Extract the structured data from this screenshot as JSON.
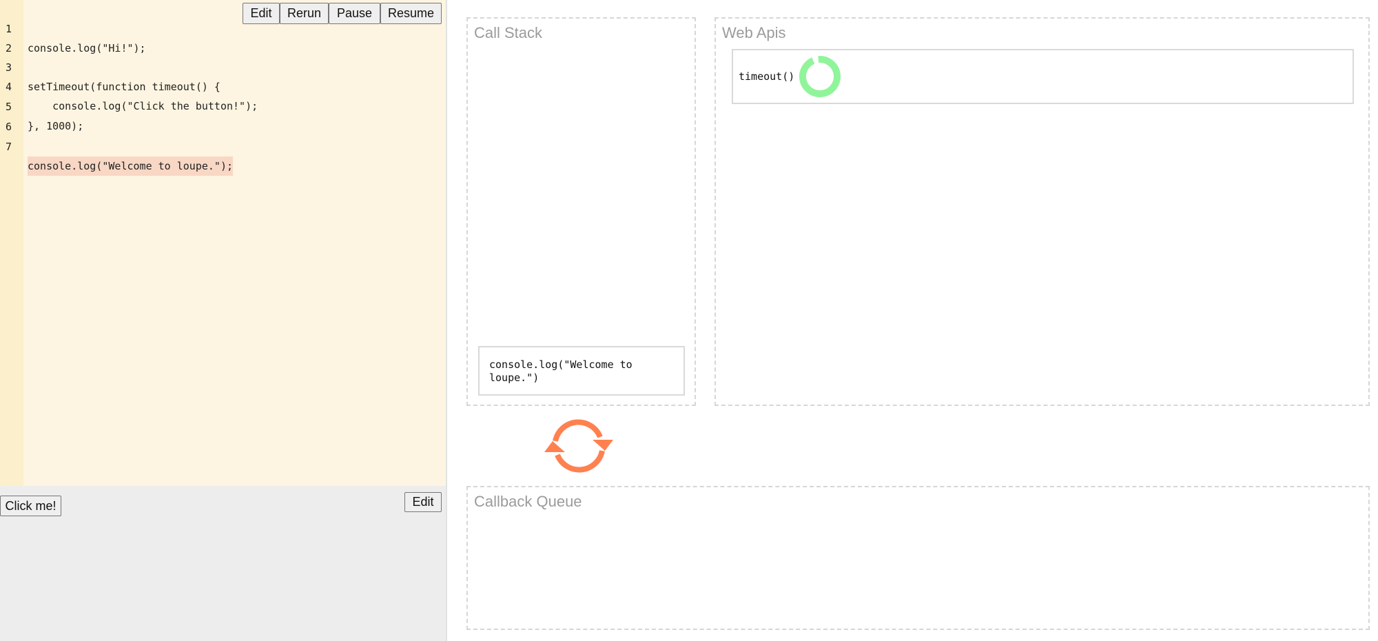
{
  "editor": {
    "lines": [
      {
        "no": "1",
        "text": "console.log(\"Hi!\");"
      },
      {
        "no": "2",
        "text": ""
      },
      {
        "no": "3",
        "text": "setTimeout(function timeout() {"
      },
      {
        "no": "4",
        "text": "    console.log(\"Click the button!\");"
      },
      {
        "no": "5",
        "text": "}, 1000);"
      },
      {
        "no": "6",
        "text": ""
      },
      {
        "no": "7",
        "text": "console.log(\"Welcome to loupe.\");"
      }
    ],
    "highlighted_line": 7,
    "toolbar": {
      "edit_label": "Edit",
      "rerun_label": "Rerun",
      "pause_label": "Pause",
      "resume_label": "Resume"
    }
  },
  "preview": {
    "click_button_label": "Click me!",
    "edit_label": "Edit"
  },
  "call_stack": {
    "title": "Call Stack",
    "frames": [
      "console.log(\"Welcome to\nloupe.\")"
    ]
  },
  "web_apis": {
    "title": "Web Apis",
    "items": [
      {
        "label": "timeout()",
        "icon": "timer-progress-icon",
        "color": "#90f59a"
      }
    ]
  },
  "event_loop": {
    "icon": "event-loop-refresh-icon",
    "color": "#ff8150"
  },
  "callback_queue": {
    "title": "Callback Queue",
    "items": []
  }
}
